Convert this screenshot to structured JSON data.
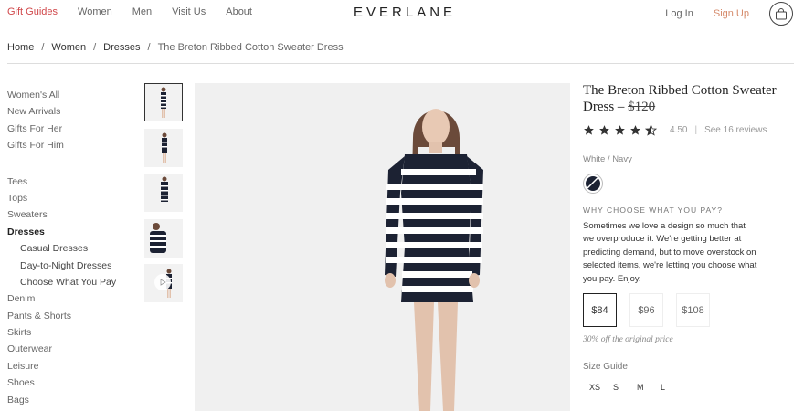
{
  "nav": {
    "left": [
      "Gift Guides",
      "Women",
      "Men",
      "Visit Us",
      "About"
    ],
    "logo": "EVERLANE",
    "login": "Log In",
    "signup": "Sign Up"
  },
  "breadcrumb": {
    "home": "Home",
    "women": "Women",
    "dresses": "Dresses",
    "current": "The Breton Ribbed Cotton Sweater Dress",
    "sep": "/"
  },
  "sidebar": {
    "group1": [
      "Women's All",
      "New Arrivals",
      "Gifts For Her",
      "Gifts For Him"
    ],
    "group2_before": [
      "Tees",
      "Tops",
      "Sweaters"
    ],
    "active": "Dresses",
    "subitems": [
      "Casual Dresses",
      "Day-to-Night Dresses",
      "Choose What You Pay"
    ],
    "group2_after": [
      "Denim",
      "Pants & Shorts",
      "Skirts",
      "Outerwear",
      "Leisure",
      "Shoes",
      "Bags"
    ]
  },
  "product": {
    "title": "The Breton Ribbed Cotton Sweater Dress",
    "dash": "–",
    "original_price": "$120",
    "rating": "4.50",
    "rating_sep": "|",
    "reviews": "See 16 reviews",
    "stars_value": 4.5,
    "stars_max": 5,
    "color": "White / Navy",
    "why_title": "WHY CHOOSE WHAT YOU PAY?",
    "description": "Sometimes we love a design so much that we overproduce it. We're getting better at predicting demand, but to move overstock on selected items, we're letting you choose what you pay. Enjoy.",
    "prices": [
      "$84",
      "$96",
      "$108"
    ],
    "selected_price": "$84",
    "discount_note": "30% off the original price",
    "size_guide": "Size Guide",
    "sizes": [
      "XS",
      "S",
      "M",
      "L"
    ]
  },
  "colors": {
    "accent_red": "#d0474a",
    "signup": "#d58a6a",
    "navy": "#1c2233"
  }
}
